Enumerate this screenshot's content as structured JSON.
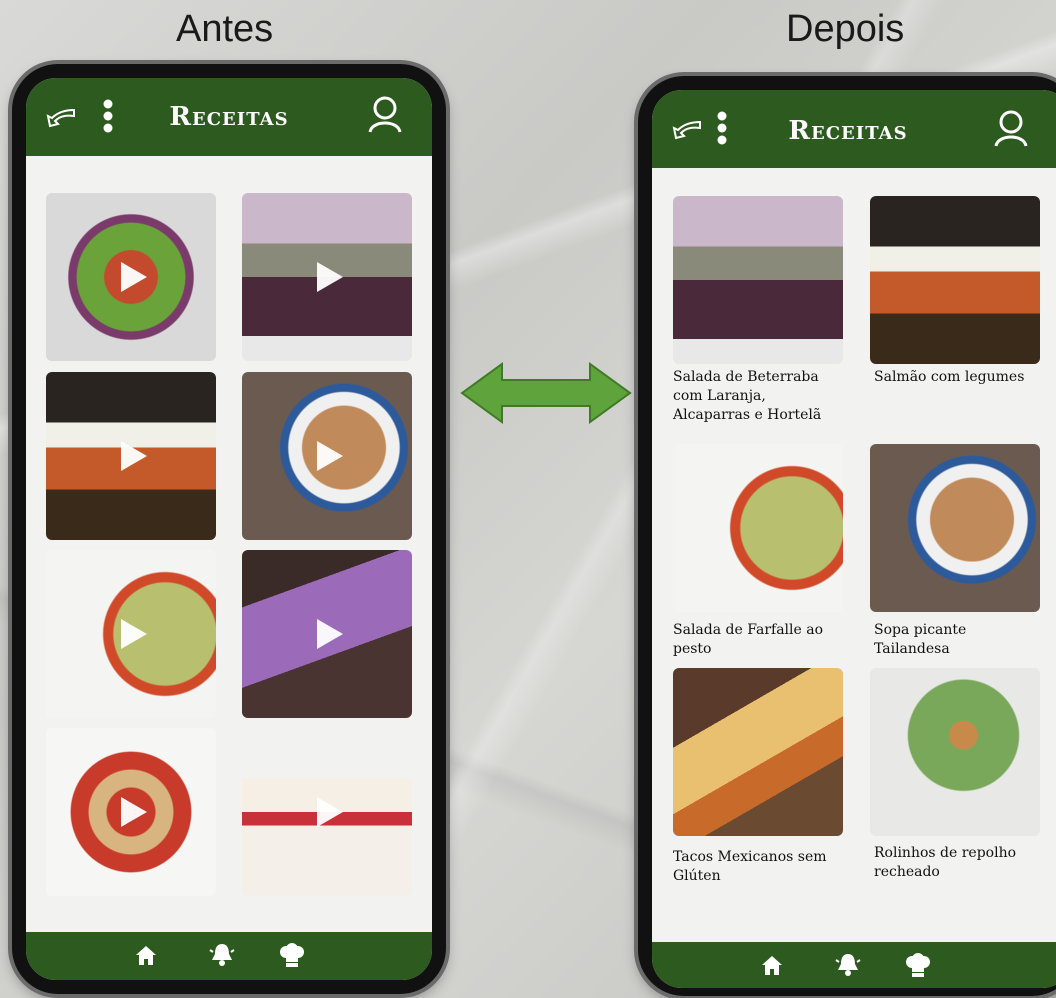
{
  "labels": {
    "before": "Antes",
    "after": "Depois"
  },
  "app": {
    "title": "Receitas"
  },
  "icons": {
    "back": "back-arrow-icon",
    "menu": "kebab-menu-icon",
    "profile": "user-profile-icon",
    "home": "home-icon",
    "bell": "bell-icon",
    "chef": "chef-hat-icon"
  },
  "colors": {
    "brand": "#2d5a1f",
    "arrow": "#5a9a3a",
    "screen": "#f2f2f0"
  },
  "recipes": [
    {
      "name": "Salada de Beterraba com Laranja, Alcaparras e Hortelã"
    },
    {
      "name": "Salmão com legumes"
    },
    {
      "name": "Salada de Farfalle ao pesto"
    },
    {
      "name": "Sopa picante Tailandesa"
    },
    {
      "name": "Tacos Mexicanos sem Glúten"
    },
    {
      "name": "Rolinhos de repolho recheado"
    }
  ]
}
